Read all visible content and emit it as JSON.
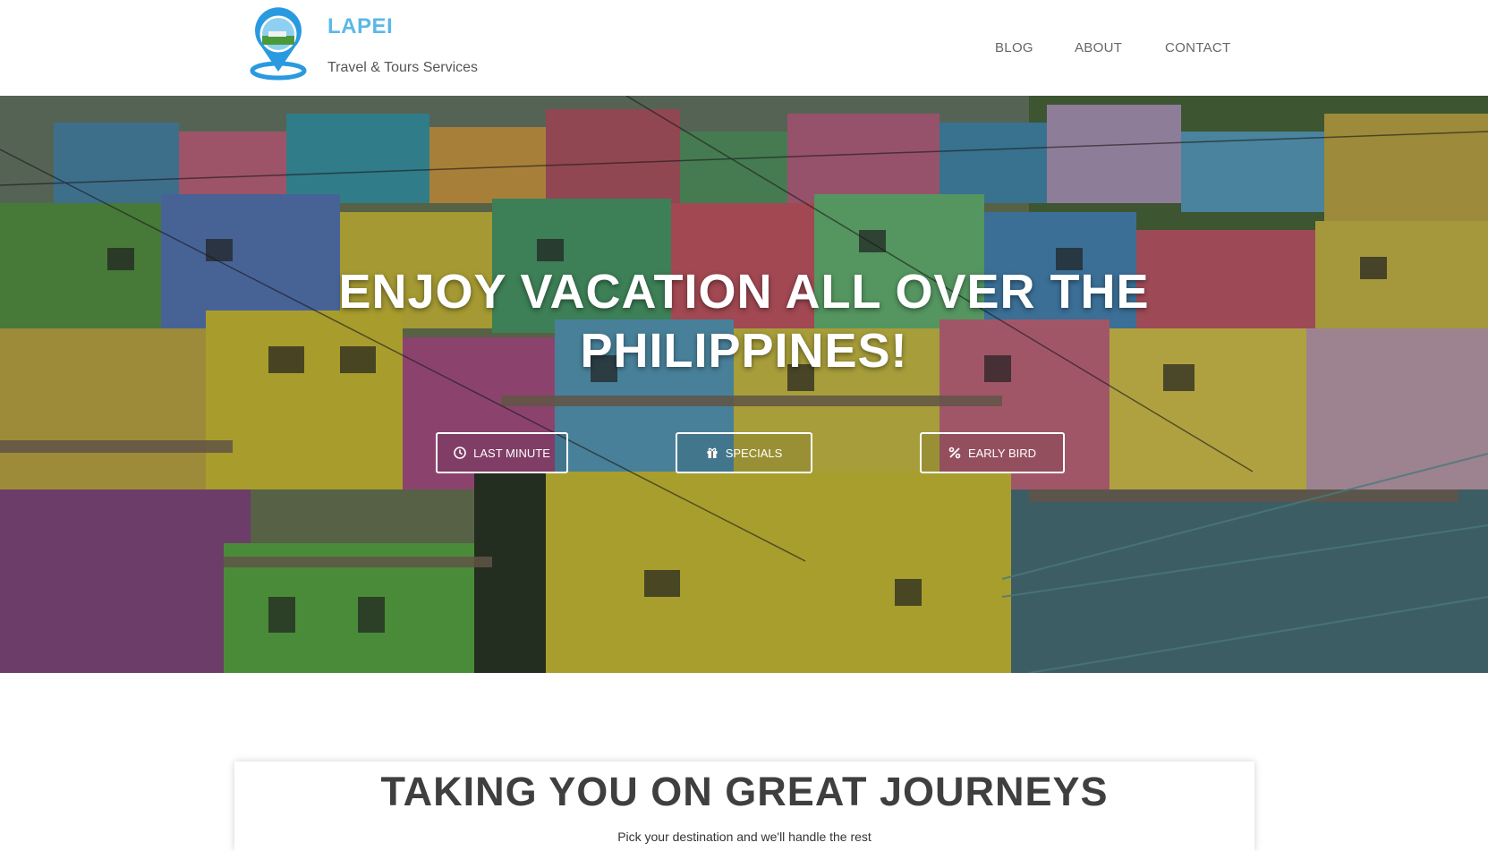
{
  "header": {
    "brand_title": "LAPEI",
    "brand_subtitle": "Travel & Tours Services",
    "nav": {
      "blog": "BLOG",
      "about": "ABOUT",
      "contact": "CONTACT"
    }
  },
  "hero": {
    "title_line1": "ENJOY VACATION ALL OVER THE",
    "title_line2": "PHILIPPINES!",
    "buttons": {
      "last_minute": {
        "label": "LAST MINUTE",
        "icon": "clock-icon"
      },
      "specials": {
        "label": "SPECIALS",
        "icon": "gift-icon"
      },
      "early_bird": {
        "label": "EARLY BIRD",
        "icon": "percent-icon"
      }
    }
  },
  "journeys": {
    "title": "TAKING YOU ON GREAT JOURNEYS",
    "subtitle": "Pick your destination and we'll handle the rest"
  },
  "colors": {
    "brand": "#5bb8e6",
    "nav_text": "#666666",
    "heading": "#3f3f3f"
  }
}
